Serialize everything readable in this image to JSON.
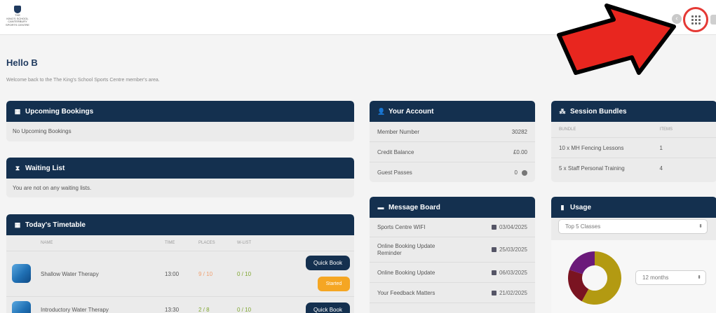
{
  "header": {
    "logo_text": "THE\nKING'S SCHOOL\nCANTERBURY\nSPORTS CENTRE",
    "back_icon": "chevron-left-icon",
    "apps_icon": "grid-icon"
  },
  "colors": {
    "navy": "#14304f",
    "orange": "#f5a623",
    "green": "#7fa630",
    "annotation_red": "#e53935"
  },
  "greeting": {
    "title": "Hello B",
    "subtitle": "Welcome back to the The King's School Sports Centre member's area."
  },
  "upcoming": {
    "title": "Upcoming Bookings",
    "icon": "calendar-icon",
    "message": "No Upcoming Bookings"
  },
  "waiting": {
    "title": "Waiting List",
    "icon": "hourglass-icon",
    "message": "You are not on any waiting lists."
  },
  "timetable": {
    "title": "Today's Timetable",
    "icon": "calendar-icon",
    "columns": {
      "name": "NAME",
      "time": "TIME",
      "places": "PLACES",
      "wlist": "W-LIST"
    },
    "rows": [
      {
        "name": "Shallow Water Therapy",
        "time": "13:00",
        "places": "9 / 10",
        "wlist": "0 / 10",
        "action": "Quick Book",
        "status": "Started",
        "places_color": "#f0a070"
      },
      {
        "name": "Introductory Water Therapy",
        "time": "13:30",
        "places": "2 / 8",
        "wlist": "0 / 10",
        "action": "Quick Book",
        "places_color": "#7fa630"
      }
    ]
  },
  "account": {
    "title": "Your Account",
    "icon": "user-icon",
    "rows": [
      {
        "label": "Member Number",
        "value": "30282"
      },
      {
        "label": "Credit Balance",
        "value": "£0.00"
      },
      {
        "label": "Guest Passes",
        "value": "0"
      }
    ]
  },
  "messages": {
    "title": "Message Board",
    "icon": "chat-icon",
    "items": [
      {
        "title": "Sports Centre WIFI",
        "date": "03/04/2025"
      },
      {
        "title": "Online Booking Update Reminder",
        "date": "25/03/2025"
      },
      {
        "title": "Online Booking Update",
        "date": "06/03/2025"
      },
      {
        "title": "Your Feedback Matters",
        "date": "21/02/2025"
      }
    ]
  },
  "bundles": {
    "title": "Session Bundles",
    "icon": "bundle-icon",
    "columns": {
      "bundle": "BUNDLE",
      "items": "ITEMS"
    },
    "rows": [
      {
        "bundle": "10 x MH Fencing Lessons",
        "items": "1"
      },
      {
        "bundle": "5 x Staff Personal Training",
        "items": "4"
      }
    ]
  },
  "usage": {
    "title": "Usage",
    "icon": "bar-chart-icon",
    "class_select": "Top 5 Classes",
    "period_select": "12 months",
    "segments": [
      {
        "fraction": 0.58,
        "color": "#b39a12"
      },
      {
        "fraction": 0.22,
        "color": "#7a1421"
      },
      {
        "fraction": 0.2,
        "color": "#6b1a7a"
      }
    ]
  }
}
